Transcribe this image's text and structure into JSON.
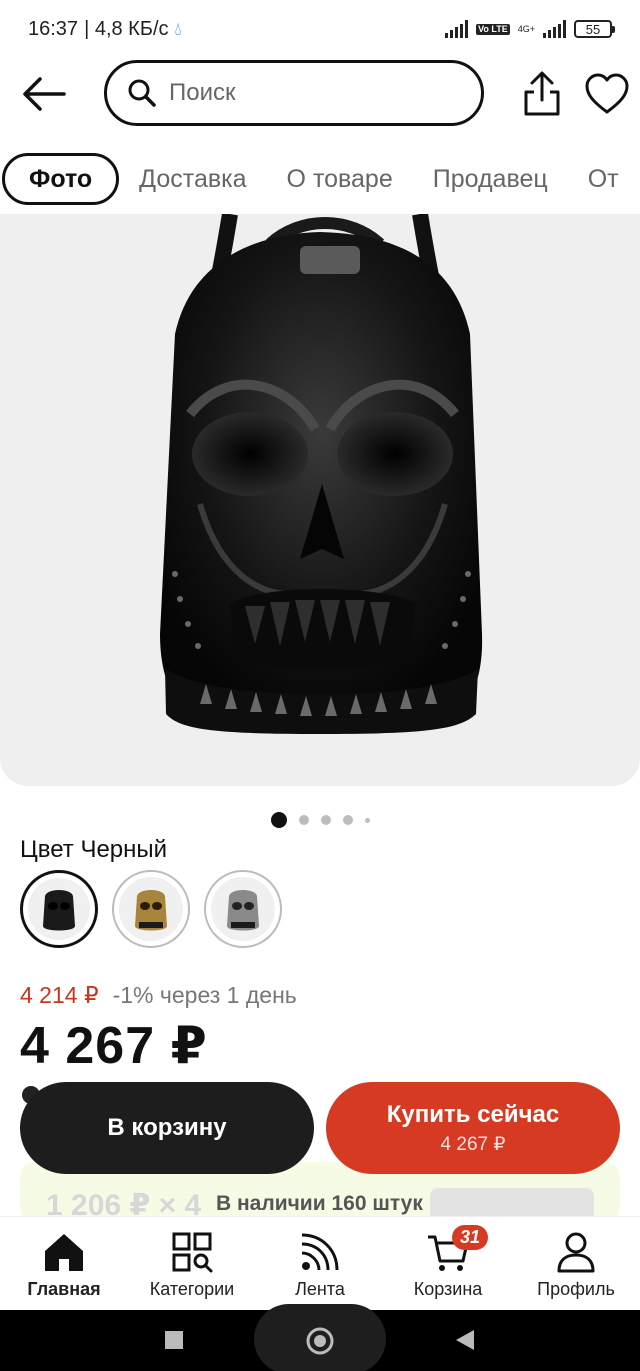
{
  "status_bar": {
    "time": "16:37",
    "speed": "| 4,8 КБ/с",
    "battery": "55",
    "volte": "Vo LTE",
    "network": "4G+"
  },
  "header": {
    "search_placeholder": "Поиск",
    "icons": [
      "arrow-left-icon",
      "search-icon",
      "share-icon",
      "heart-icon"
    ]
  },
  "tabs": [
    {
      "label": "Фото",
      "active": true
    },
    {
      "label": "Доставка",
      "active": false
    },
    {
      "label": "О товаре",
      "active": false
    },
    {
      "label": "Продавец",
      "active": false
    },
    {
      "label": "От",
      "active": false
    }
  ],
  "gallery": {
    "image": "black 3D skull backpack with spikes",
    "pages": 5,
    "active_page": 1
  },
  "color": {
    "label": "Цвет Черный",
    "options": [
      {
        "name": "black",
        "hex": "#1a1a1a",
        "selected": true
      },
      {
        "name": "gold",
        "hex": "#a8853a",
        "selected": false
      },
      {
        "name": "silver",
        "hex": "#8a8a8a",
        "selected": false
      }
    ]
  },
  "price": {
    "old": "4 214 ₽",
    "discount_note": "-1% через 1 день",
    "current": "4 267 ₽"
  },
  "actions": {
    "cart_label": "В корзину",
    "buy_label": "Купить сейчас",
    "buy_price": "4 267 ₽"
  },
  "promo": {
    "faded_text": "1 206 ₽ × 4",
    "stock_text": "В наличии 160 штук"
  },
  "bottom_nav": [
    {
      "label": "Главная",
      "icon": "home-icon",
      "active": true
    },
    {
      "label": "Категории",
      "icon": "categories-icon",
      "active": false
    },
    {
      "label": "Лента",
      "icon": "feed-icon",
      "active": false
    },
    {
      "label": "Корзина",
      "icon": "cart-icon",
      "active": false,
      "badge": "31"
    },
    {
      "label": "Профиль",
      "icon": "profile-icon",
      "active": false
    }
  ],
  "colors": {
    "accent": "#d63a22",
    "dark": "#1d1d1d",
    "promo_bg": "#f6fbe6"
  }
}
